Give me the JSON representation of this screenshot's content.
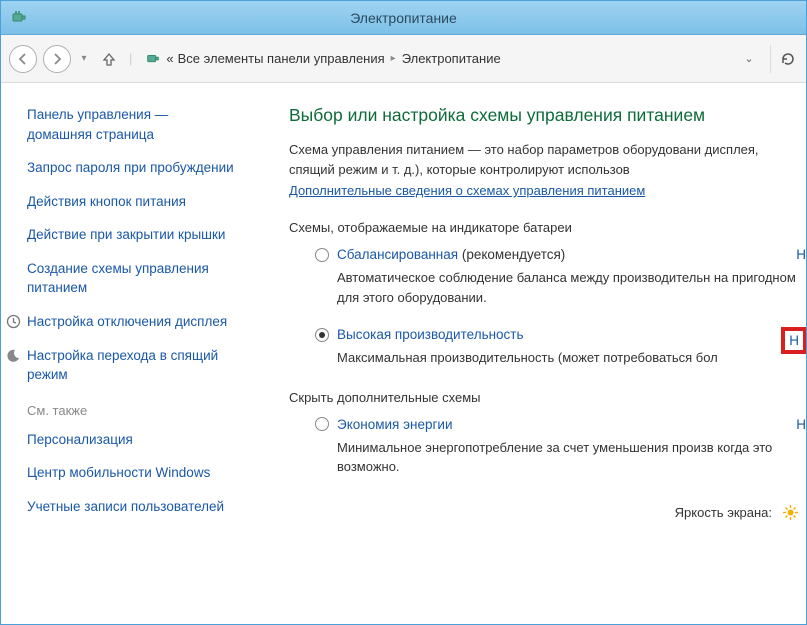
{
  "window": {
    "title": "Электропитание"
  },
  "breadcrumb": {
    "level1": "Все элементы панели управления",
    "level2": "Электропитание"
  },
  "sidebar": {
    "home1": "Панель управления —",
    "home2": "домашняя страница",
    "links": [
      "Запрос пароля при пробуждении",
      "Действия кнопок питания",
      "Действие при закрытии крышки",
      "Создание схемы управления питанием",
      "Настройка отключения дисплея",
      "Настройка перехода в спящий режим"
    ],
    "see_also": "См. также",
    "related": [
      "Персонализация",
      "Центр мобильности Windows",
      "Учетные записи пользователей"
    ]
  },
  "main": {
    "heading": "Выбор или настройка схемы управления питанием",
    "desc": "Схема управления питанием — это набор параметров оборудовани дисплея, спящий режим и т. д.), которые контролируют использов",
    "more_link": "Дополнительные сведения о схемах управления питанием",
    "section1": "Схемы, отображаемые на индикаторе батареи",
    "plan1": {
      "name": "Сбалансированная",
      "rec": " (рекомендуется)",
      "desc": "Автоматическое соблюдение баланса между производительн на пригодном для этого оборудовании.",
      "action": "Н"
    },
    "plan2": {
      "name": "Высокая производительность",
      "desc": "Максимальная производительность (может потребоваться бол",
      "action": "Н"
    },
    "section2": "Скрыть дополнительные схемы",
    "plan3": {
      "name": "Экономия энергии",
      "desc": "Минимальное энергопотребление за счет уменьшения произв когда это возможно.",
      "action": "Н"
    },
    "brightness_label": "Яркость экрана:"
  }
}
